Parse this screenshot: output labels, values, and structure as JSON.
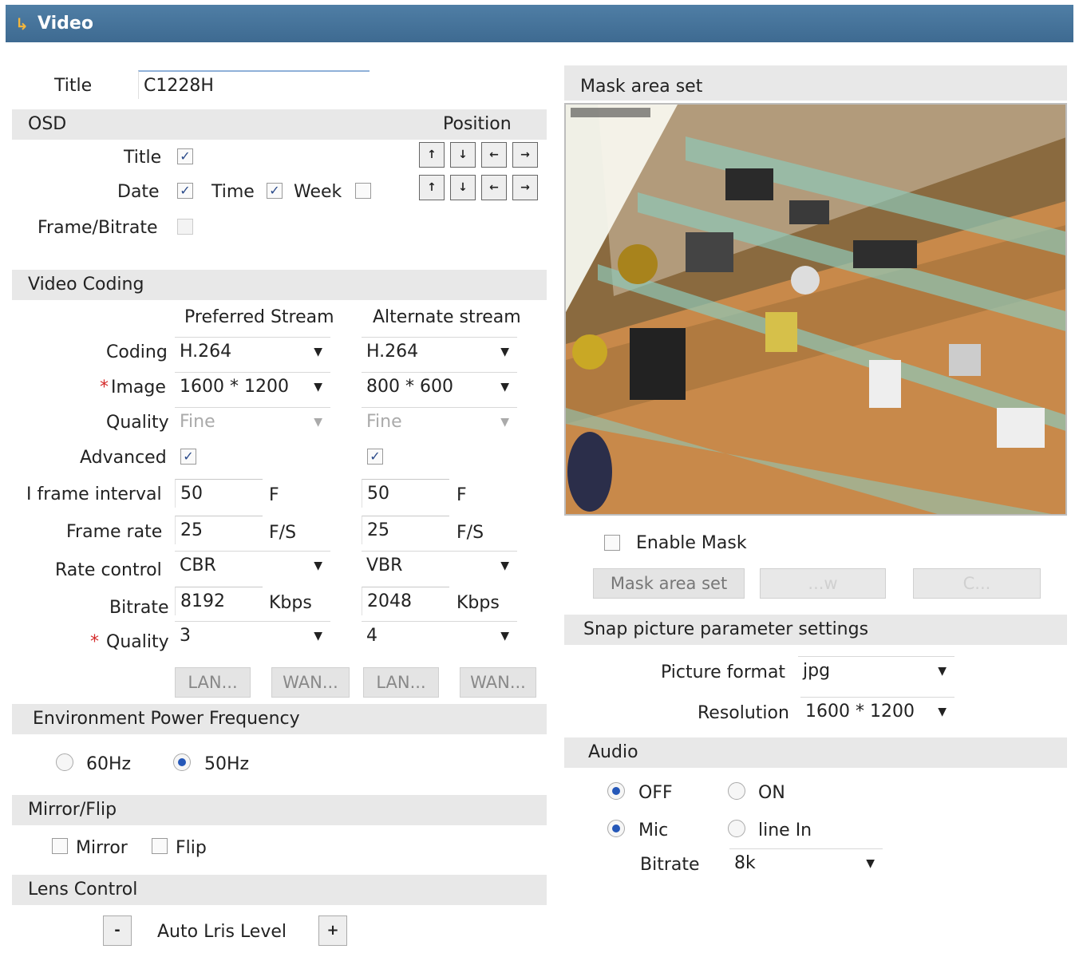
{
  "header": {
    "title": "Video"
  },
  "title_field": {
    "label": "Title",
    "value": "C1228H"
  },
  "osd": {
    "heading": "OSD",
    "position_label": "Position",
    "title": "Title",
    "date": "Date",
    "time": "Time",
    "week": "Week",
    "frame_bitrate": "Frame/Bitrate",
    "check_mark": "✓",
    "title_checked": true,
    "date_checked": true,
    "time_checked": true,
    "week_checked": false,
    "frame_bitrate_checked": false
  },
  "video_coding": {
    "heading": "Video Coding",
    "preferred": "Preferred Stream",
    "alternate": "Alternate stream",
    "labels": {
      "coding": "Coding",
      "image": "Image",
      "quality": "Quality",
      "advanced": "Advanced",
      "iframe": "I frame interval",
      "frame_rate": "Frame rate",
      "rate_control": "Rate control",
      "bitrate": "Bitrate",
      "quality2": "Quality",
      "required": "*"
    },
    "pref": {
      "coding": "H.264",
      "image": "1600 * 1200",
      "quality": "Fine",
      "iframe": "50",
      "iframe_unit": "F",
      "frame_rate": "25",
      "frame_rate_unit": "F/S",
      "rate_control": "CBR",
      "bitrate": "8192",
      "bitrate_unit": "Kbps",
      "quality2": "3",
      "advanced": true
    },
    "alt": {
      "coding": "H.264",
      "image": "800 * 600",
      "quality": "Fine",
      "iframe": "50",
      "iframe_unit": "F",
      "frame_rate": "25",
      "frame_rate_unit": "F/S",
      "rate_control": "VBR",
      "bitrate": "2048",
      "bitrate_unit": "Kbps",
      "quality2": "4",
      "advanced": true
    },
    "buttons": [
      "LAN...",
      "WAN...",
      "LAN...",
      "WAN..."
    ]
  },
  "power_freq": {
    "heading": "Environment Power Frequency",
    "opt1": "60Hz",
    "opt2": "50Hz",
    "selected": "50Hz"
  },
  "mirror_flip": {
    "heading": "Mirror/Flip",
    "mirror": "Mirror",
    "flip": "Flip"
  },
  "lens": {
    "heading": "Lens Control",
    "minus": "-",
    "label": "Auto Lris Level",
    "plus": "+"
  },
  "mask": {
    "heading": "Mask area set",
    "enable": "Enable Mask",
    "btn_set": "Mask area set",
    "btn_2": "...w",
    "btn_3": "C..."
  },
  "snap": {
    "heading": "Snap picture parameter settings",
    "format_label": "Picture format",
    "format": "jpg",
    "res_label": "Resolution",
    "res": "1600 * 1200"
  },
  "audio": {
    "heading": "Audio",
    "off": "OFF",
    "on": "ON",
    "mic": "Mic",
    "line_in": "line In",
    "bitrate_label": "Bitrate",
    "bitrate": "8k"
  },
  "colors": {
    "header": "#3e6a91",
    "section": "#e8e8e8",
    "accent": "#2457b8"
  }
}
